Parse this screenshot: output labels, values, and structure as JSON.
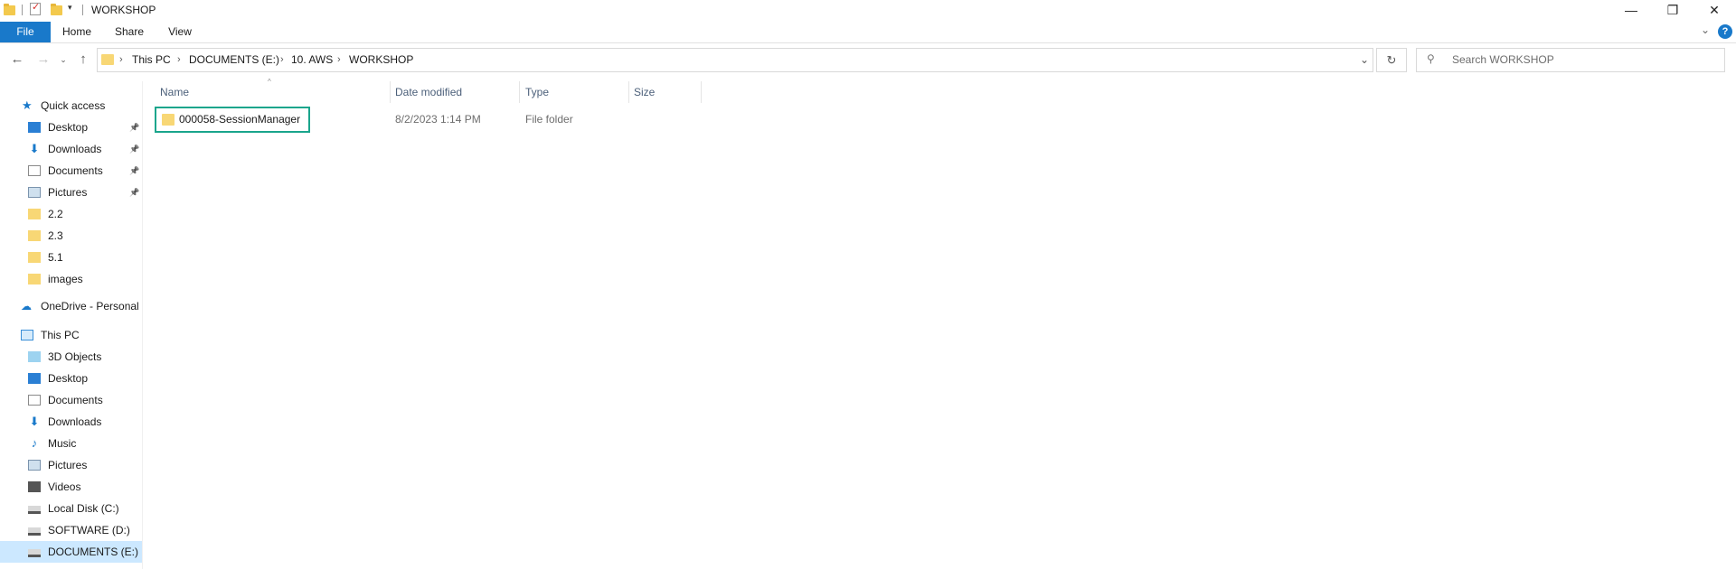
{
  "window": {
    "title": "WORKSHOP",
    "minimize_icon": "minimize-icon",
    "restore_icon": "restore-icon",
    "close_icon": "close-icon"
  },
  "ribbon": {
    "tabs": [
      "File",
      "Home",
      "Share",
      "View"
    ],
    "file_tab_color": "#1979ca"
  },
  "address": {
    "crumbs": [
      "This PC",
      "DOCUMENTS (E:)",
      "10. AWS",
      "WORKSHOP"
    ]
  },
  "search": {
    "placeholder": "Search WORKSHOP"
  },
  "nav": {
    "quick_access": "Quick access",
    "quick_items": [
      {
        "label": "Desktop",
        "icon": "desktop-icon",
        "pinned": true
      },
      {
        "label": "Downloads",
        "icon": "downloads-icon",
        "pinned": true
      },
      {
        "label": "Documents",
        "icon": "documents-icon",
        "pinned": true
      },
      {
        "label": "Pictures",
        "icon": "pictures-icon",
        "pinned": true
      },
      {
        "label": "2.2",
        "icon": "folder-icon",
        "pinned": false
      },
      {
        "label": "2.3",
        "icon": "folder-icon",
        "pinned": false
      },
      {
        "label": "5.1",
        "icon": "folder-icon",
        "pinned": false
      },
      {
        "label": "images",
        "icon": "folder-icon",
        "pinned": false
      }
    ],
    "onedrive": "OneDrive - Personal",
    "this_pc": "This PC",
    "pc_items": [
      {
        "label": "3D Objects",
        "icon": "3d-objects-icon"
      },
      {
        "label": "Desktop",
        "icon": "desktop-icon"
      },
      {
        "label": "Documents",
        "icon": "documents-icon"
      },
      {
        "label": "Downloads",
        "icon": "downloads-icon"
      },
      {
        "label": "Music",
        "icon": "music-icon"
      },
      {
        "label": "Pictures",
        "icon": "pictures-icon"
      },
      {
        "label": "Videos",
        "icon": "videos-icon"
      },
      {
        "label": "Local Disk (C:)",
        "icon": "drive-icon"
      },
      {
        "label": "SOFTWARE (D:)",
        "icon": "drive-icon"
      },
      {
        "label": "DOCUMENTS (E:)",
        "icon": "drive-icon",
        "selected": true
      }
    ]
  },
  "columns": [
    "Name",
    "Date modified",
    "Type",
    "Size"
  ],
  "files": [
    {
      "name": "000058-SessionManager",
      "date": "8/2/2023 1:14 PM",
      "type": "File folder",
      "size": ""
    }
  ],
  "colors": {
    "selection_highlight": "#cce8ff",
    "row_outline": "#1aa58c",
    "folder": "#f8d775"
  }
}
